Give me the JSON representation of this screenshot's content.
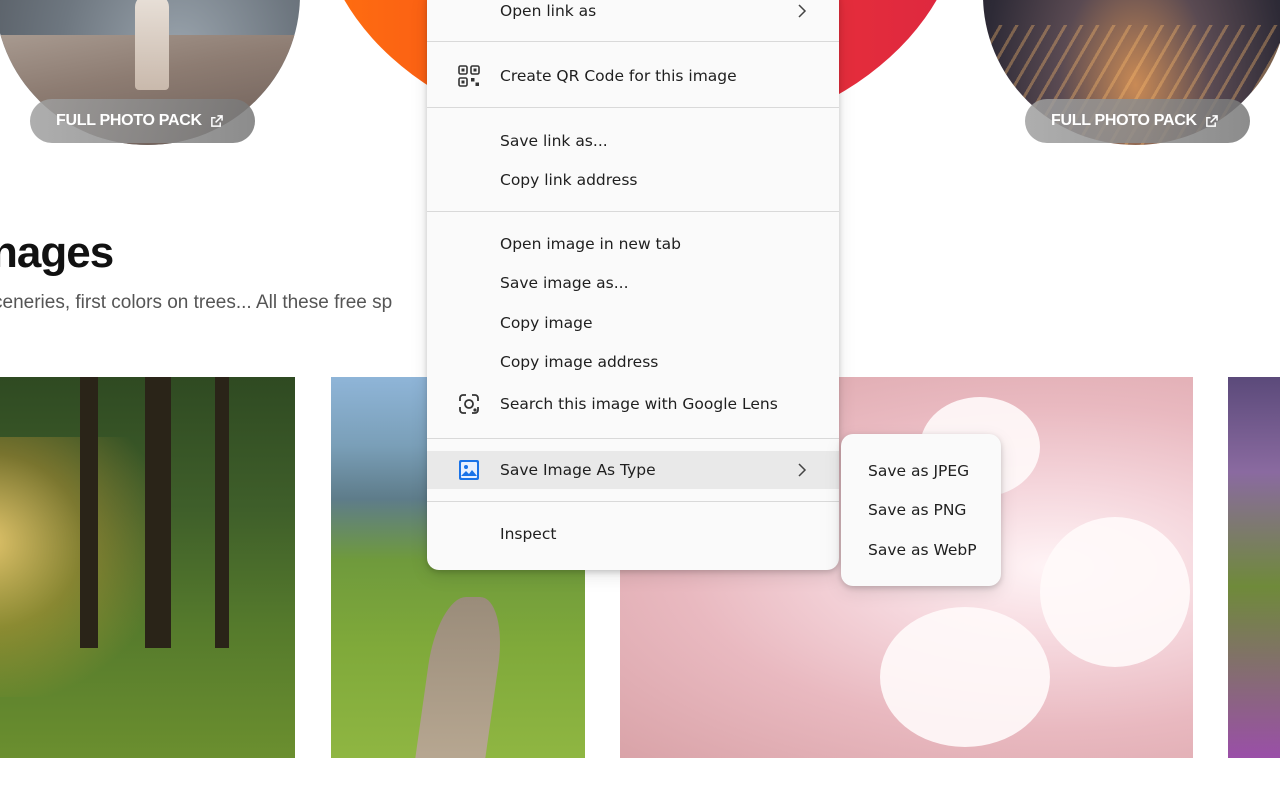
{
  "page": {
    "pill_label": "FULL PHOTO PACK",
    "section_title": "nages",
    "section_subtitle": "ceneries, first colors on trees... All these free sp"
  },
  "context_menu": {
    "items": [
      {
        "label": "Open link as",
        "icon": "",
        "submenu": true
      },
      {
        "label": "Create QR Code for this image",
        "icon": "qr-code-icon"
      },
      {
        "label": "Save link as..."
      },
      {
        "label": "Copy link address"
      },
      {
        "label": "Open image in new tab"
      },
      {
        "label": "Save image as..."
      },
      {
        "label": "Copy image"
      },
      {
        "label": "Copy image address"
      },
      {
        "label": "Search this image with Google Lens",
        "icon": "google-lens-icon"
      },
      {
        "label": "Save Image As Type",
        "icon": "image-icon",
        "submenu": true,
        "highlighted": true
      },
      {
        "label": "Inspect"
      }
    ]
  },
  "submenu": {
    "items": [
      {
        "label": "Save as JPEG"
      },
      {
        "label": "Save as PNG"
      },
      {
        "label": "Save as WebP"
      }
    ]
  },
  "colors": {
    "accent_icon": "#1a73e8",
    "menu_bg": "#fafafa",
    "highlight_bg": "#e9e9e9"
  }
}
